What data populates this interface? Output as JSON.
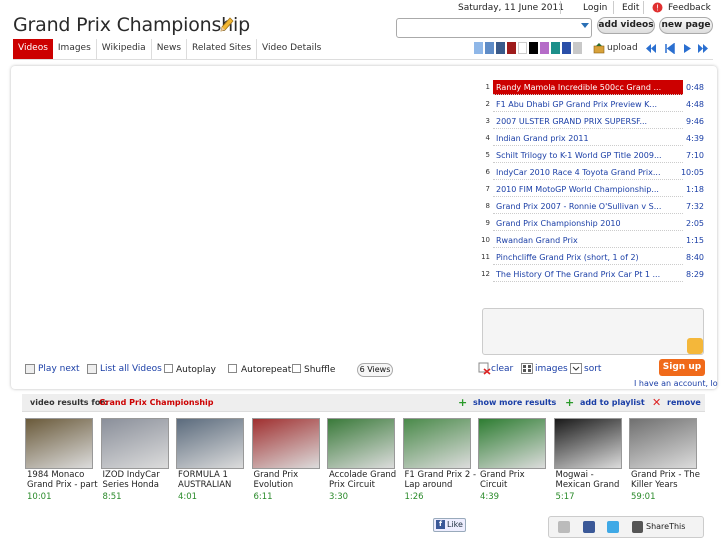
{
  "header": {
    "title": "Grand Prix Championship",
    "date": "Saturday, 11 June 2011",
    "links": [
      "Login",
      "Edit",
      "Feedback"
    ],
    "search_value": "",
    "add_videos": "add videos",
    "new_page": "new page"
  },
  "tabs": [
    "Videos",
    "Images",
    "Wikipedia",
    "News",
    "Related Sites",
    "Video Details"
  ],
  "toolbar": {
    "upload": "upload",
    "swatches": [
      "#8fb7e8",
      "#5f8cc7",
      "#3a5a8a",
      "#9e1b1b",
      "#ffffff",
      "#000000",
      "#b56cc8",
      "#1c8f8a",
      "#2a4fa8",
      "#c8c8c8"
    ]
  },
  "playlist": [
    {
      "num": "1",
      "title": "Randy Mamola Incredible 500cc Grand ...",
      "dur": "0:48",
      "selected": true
    },
    {
      "num": "2",
      "title": "F1 Abu Dhabi GP Grand Prix Preview K...",
      "dur": "4:48"
    },
    {
      "num": "3",
      "title": "2007 ULSTER GRAND PRIX SUPERSF...",
      "dur": "9:46"
    },
    {
      "num": "4",
      "title": "Indian Grand prix 2011",
      "dur": "4:39"
    },
    {
      "num": "5",
      "title": "Schilt Trilogy to K-1 World GP Title 2009...",
      "dur": "7:10"
    },
    {
      "num": "6",
      "title": "IndyCar 2010 Race 4 Toyota Grand Prix...",
      "dur": "10:05"
    },
    {
      "num": "7",
      "title": "2010 FIM MotoGP World Championship...",
      "dur": "1:18"
    },
    {
      "num": "8",
      "title": "Grand Prix 2007 - Ronnie O'Sullivan v S...",
      "dur": "7:32"
    },
    {
      "num": "9",
      "title": "Grand Prix Championship 2010",
      "dur": "2:05"
    },
    {
      "num": "10",
      "title": "Rwandan Grand Prix",
      "dur": "1:15"
    },
    {
      "num": "11",
      "title": "Pinchcliffe Grand Prix (short, 1 of 2)",
      "dur": "8:40"
    },
    {
      "num": "12",
      "title": "The History Of The Grand Prix Car Pt 1 ...",
      "dur": "8:29"
    }
  ],
  "controls": {
    "play_next": "Play next",
    "list_all": "List all Videos",
    "autoplay": "Autoplay",
    "autorepeat": "Autorepeat",
    "shuffle": "Shuffle",
    "views": "6 Views",
    "clear": "clear",
    "images": "images",
    "sort": "sort",
    "signup": "Sign up",
    "account": "I have an account, lo"
  },
  "results": {
    "label": "video results for:",
    "term": "Grand Prix Championship",
    "show_more": "show more results",
    "add_playlist": "add to playlist",
    "remove": "remove",
    "videos": [
      {
        "title": "1984 Monaco Grand Prix - part",
        "dur": "10:01",
        "color": "#6a5a3a"
      },
      {
        "title": "IZOD IndyCar Series Honda",
        "dur": "8:51",
        "color": "#8a8f9a"
      },
      {
        "title": "FORMULA 1 AUSTRALIAN",
        "dur": "4:01",
        "color": "#5b6b7d"
      },
      {
        "title": "Grand Prix Evolution",
        "dur": "6:11",
        "color": "#a03030"
      },
      {
        "title": "Accolade Grand Prix Circuit",
        "dur": "3:30",
        "color": "#3a7a3a"
      },
      {
        "title": "F1 Grand Prix 2 - Lap around",
        "dur": "1:26",
        "color": "#4a8a4a"
      },
      {
        "title": "Grand Prix Circuit",
        "dur": "4:39",
        "color": "#2e7d32"
      },
      {
        "title": "Mogwai - Mexican Grand",
        "dur": "5:17",
        "color": "#1a1a1a"
      },
      {
        "title": "Grand Prix - The Killer Years",
        "dur": "59:01",
        "color": "#707070"
      }
    ]
  },
  "footer": {
    "like": "Like",
    "share": "ShareThis"
  }
}
